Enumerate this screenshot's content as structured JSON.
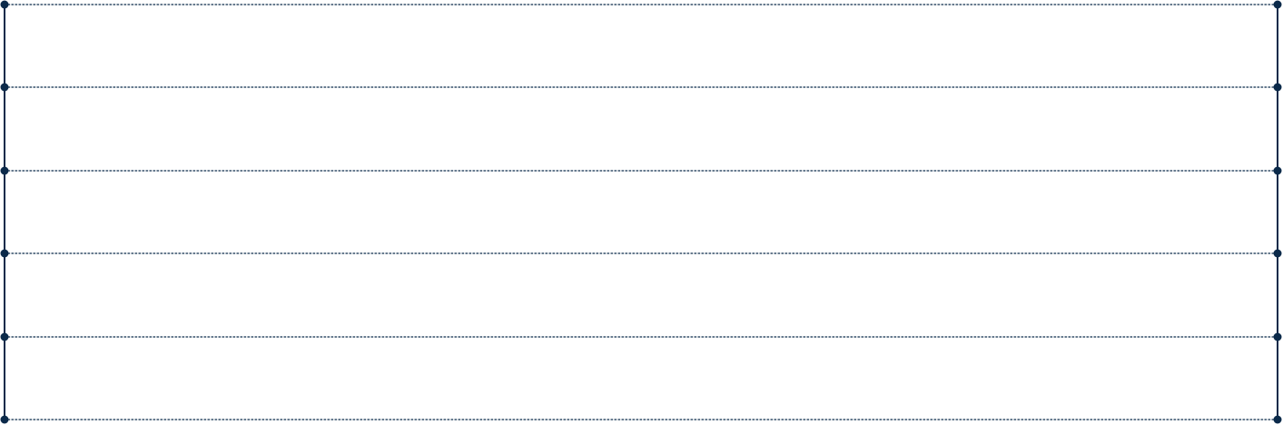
{
  "diagram": {
    "line_color": "#0b2a4a",
    "row_count": 6,
    "rows": [
      {
        "id": "row-1"
      },
      {
        "id": "row-2"
      },
      {
        "id": "row-3"
      },
      {
        "id": "row-4"
      },
      {
        "id": "row-5"
      },
      {
        "id": "row-6"
      }
    ],
    "side_rails": [
      "left",
      "right"
    ],
    "connector_style": "dotted",
    "endpoint_marker": "dot"
  }
}
